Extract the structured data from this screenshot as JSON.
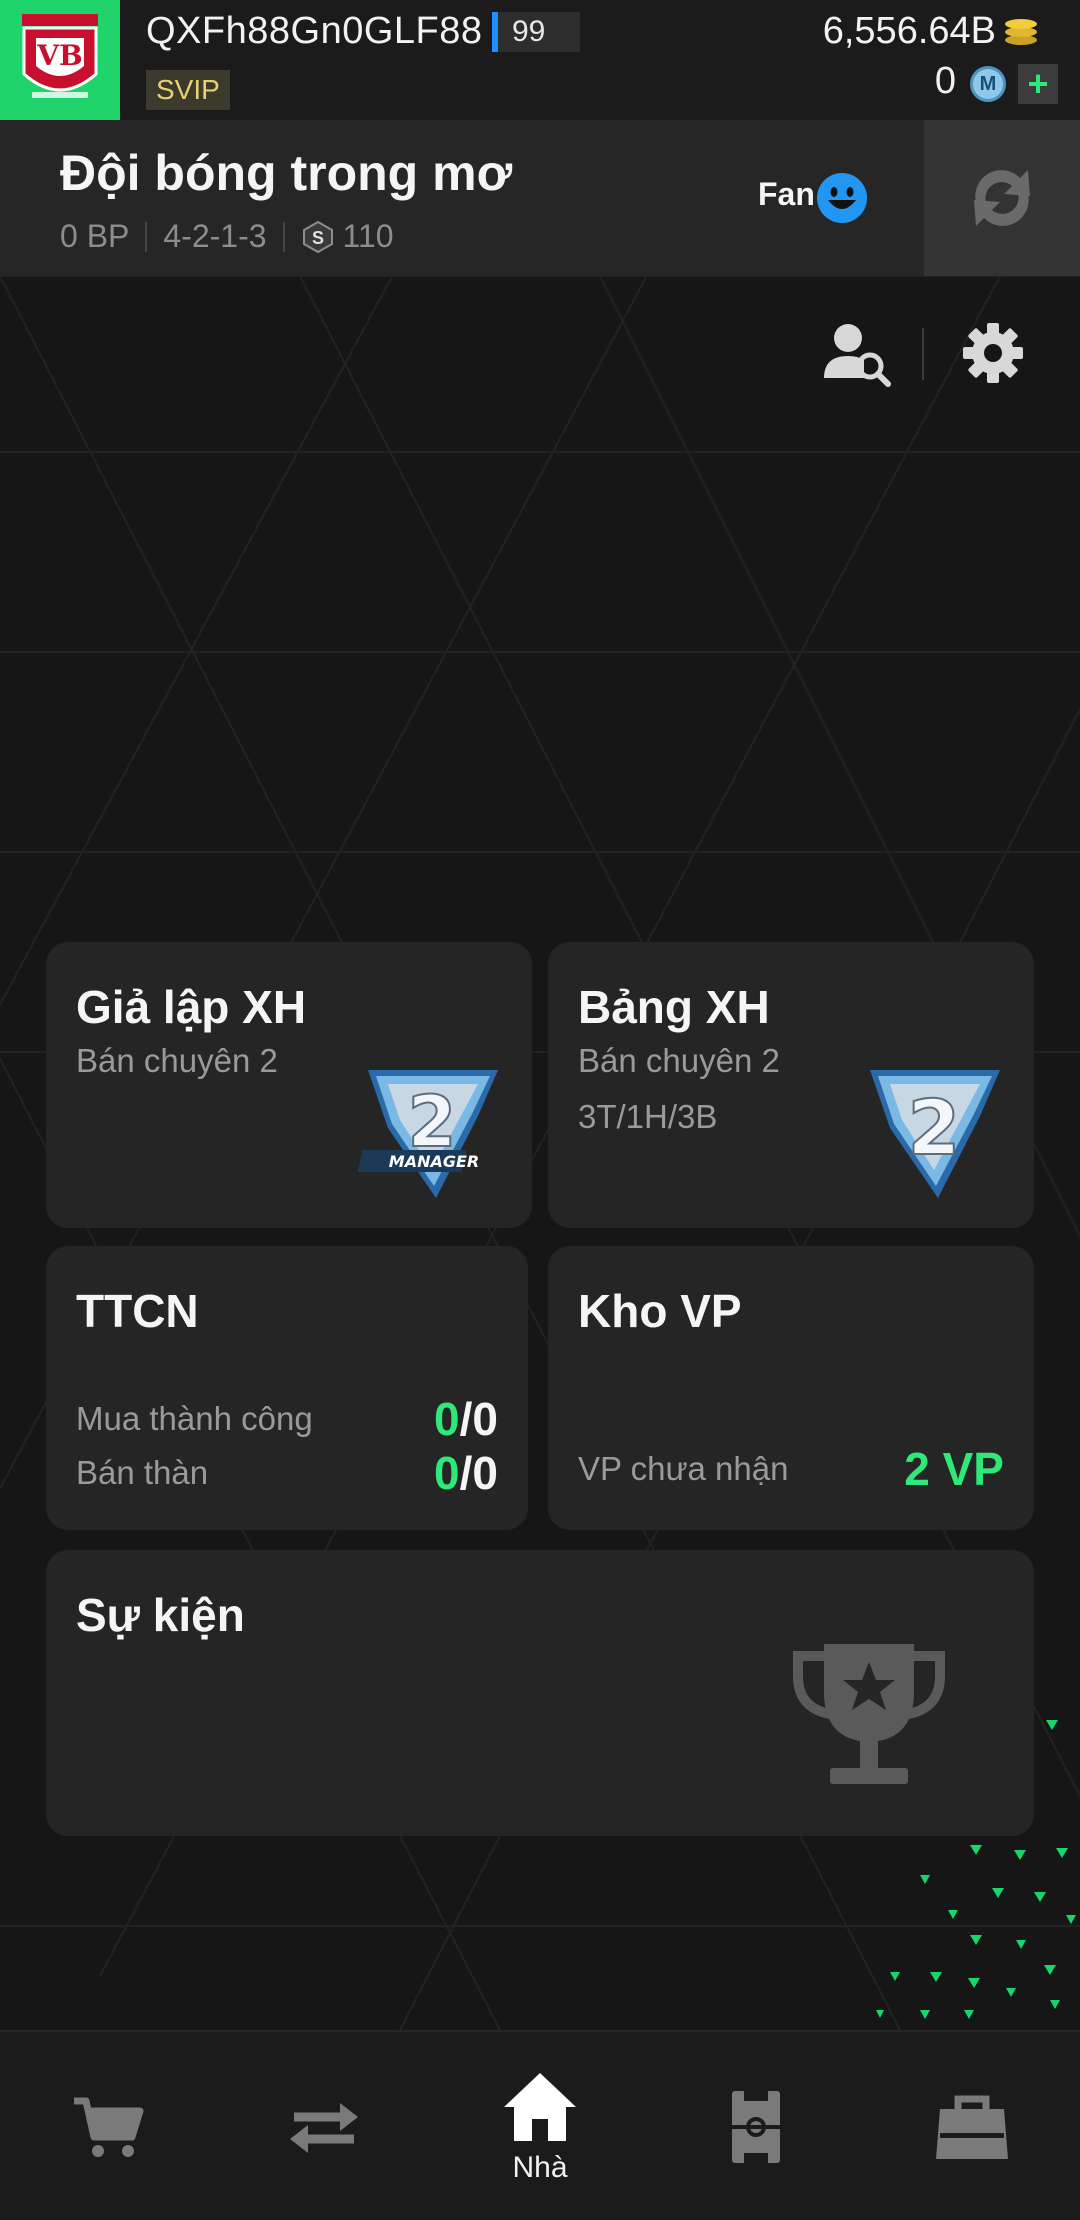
{
  "topbar": {
    "club_logo_text": "VB",
    "username": "QXFh88Gn0GLF88",
    "level": "99",
    "vip": "SVIP",
    "coins": "6,556.64B",
    "mc": "0",
    "mc_icon_text": "M",
    "plus": "+"
  },
  "team": {
    "name": "Đội bóng trong mơ",
    "bp": "0 BP",
    "formation": "4-2-1-3",
    "s_icon": "S",
    "salary": "110",
    "fan_label": "Fan"
  },
  "cards": {
    "sim": {
      "title": "Giả lập XH",
      "sub": "Bán chuyên 2"
    },
    "rank": {
      "title": "Bảng XH",
      "sub": "Bán chuyên 2",
      "record": "3T/1H/3B"
    },
    "ttcn": {
      "title": "TTCN",
      "buy_label": "Mua thành công",
      "buy_done": "0",
      "buy_total": "/0",
      "sell_label": "Bán thàn",
      "sell_done": "0",
      "sell_total": "/0"
    },
    "kho": {
      "title": "Kho VP",
      "vp_label": "VP chưa nhận",
      "vp_value": "2 VP"
    },
    "event": {
      "title": "Sự kiện"
    }
  },
  "nav": {
    "items": [
      {
        "icon": "cart-icon",
        "label": ""
      },
      {
        "icon": "transfer-icon",
        "label": ""
      },
      {
        "icon": "home-icon",
        "label": "Nhà"
      },
      {
        "icon": "pitch-icon",
        "label": ""
      },
      {
        "icon": "bag-icon",
        "label": ""
      }
    ]
  },
  "colors": {
    "accent_green": "#2ee87a",
    "logo_bg": "#1fd46b",
    "level_bar": "#1e90ff",
    "fan_face": "#2196f3",
    "vip_text": "#e6d06f"
  }
}
